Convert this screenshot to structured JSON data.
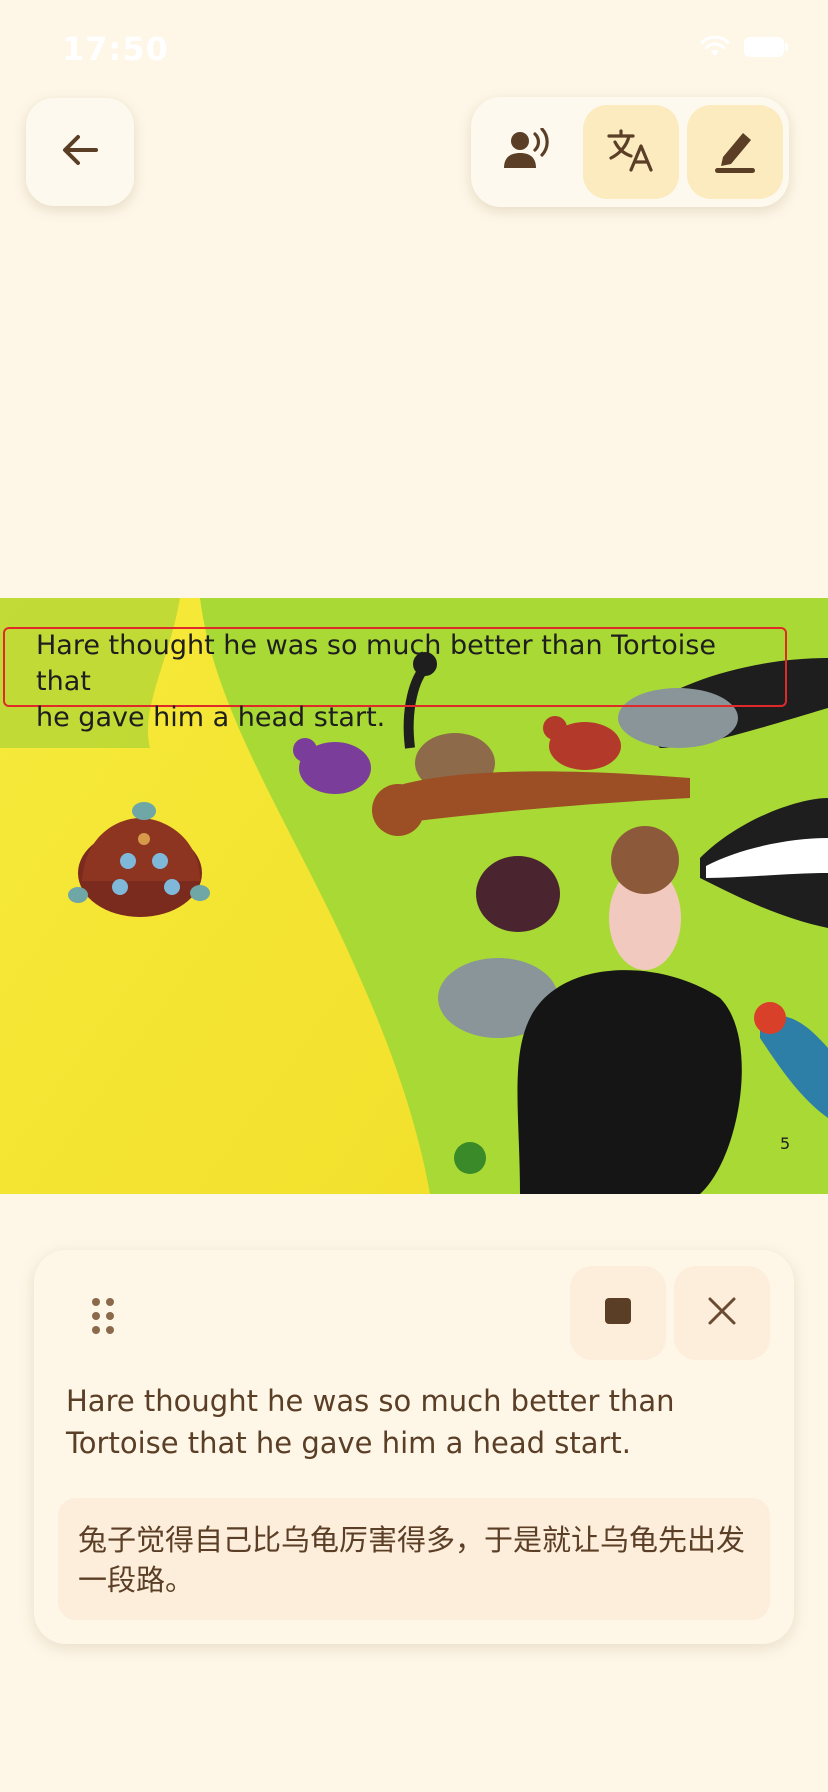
{
  "status": {
    "time": "17:50"
  },
  "colors": {
    "background": "#FEF7E8",
    "accent_brown": "#5A3E26",
    "active_button": "#FBEBBE",
    "panel_button": "#FDEDDB",
    "highlight": "#E02A2A"
  },
  "toolbar": {
    "back_icon": "arrow-left-icon",
    "buttons": [
      {
        "icon": "speaker-voice-icon",
        "active": false
      },
      {
        "icon": "translate-icon",
        "active": true
      },
      {
        "icon": "pencil-edit-icon",
        "active": true
      }
    ]
  },
  "page": {
    "text_line1": "Hare thought he was so much better than Tortoise that",
    "text_line2": "he gave him a head start.",
    "number": "5"
  },
  "panel": {
    "english": "Hare thought he was so much better than Tortoise that he gave him a head start.",
    "translation": "兔子觉得自己比乌龟厉害得多，于是就让乌龟先出发一段路。",
    "stop_icon": "stop-icon",
    "close_icon": "close-icon",
    "drag_icon": "drag-handle-icon"
  }
}
